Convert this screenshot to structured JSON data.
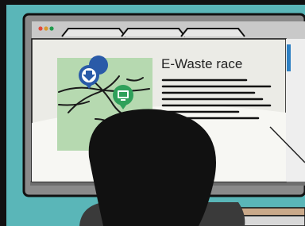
{
  "illustration": {
    "subject": "person-viewing-website-on-monitor",
    "window": {
      "controls": [
        "close-dot",
        "minimize-dot",
        "maximize-dot"
      ],
      "tab_count": 3
    },
    "article": {
      "title": "E-Waste race",
      "line_count": 7
    },
    "map": {
      "icons": [
        "recycle-arrow-pin-icon",
        "monitor-pin-icon"
      ]
    },
    "colors": {
      "wall": "#5ab6b8",
      "bezel": "#8a8a8a",
      "map": "#b6d9b0",
      "pin_blue": "#2a5aa8",
      "pin_green": "#2fa05a",
      "hair": "#111111"
    }
  }
}
